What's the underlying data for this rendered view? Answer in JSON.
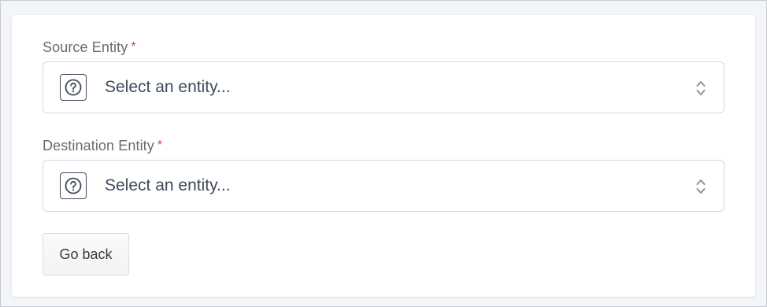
{
  "form": {
    "source": {
      "label": "Source Entity",
      "required_mark": "*",
      "placeholder": "Select an entity...",
      "icon": "question-circle-icon"
    },
    "destination": {
      "label": "Destination Entity",
      "required_mark": "*",
      "placeholder": "Select an entity...",
      "icon": "question-circle-icon"
    },
    "back_label": "Go back"
  },
  "colors": {
    "required": "#d93f3f",
    "text_dark": "#3e4a5c",
    "label": "#6b6b6b",
    "border": "#d6d9de"
  }
}
